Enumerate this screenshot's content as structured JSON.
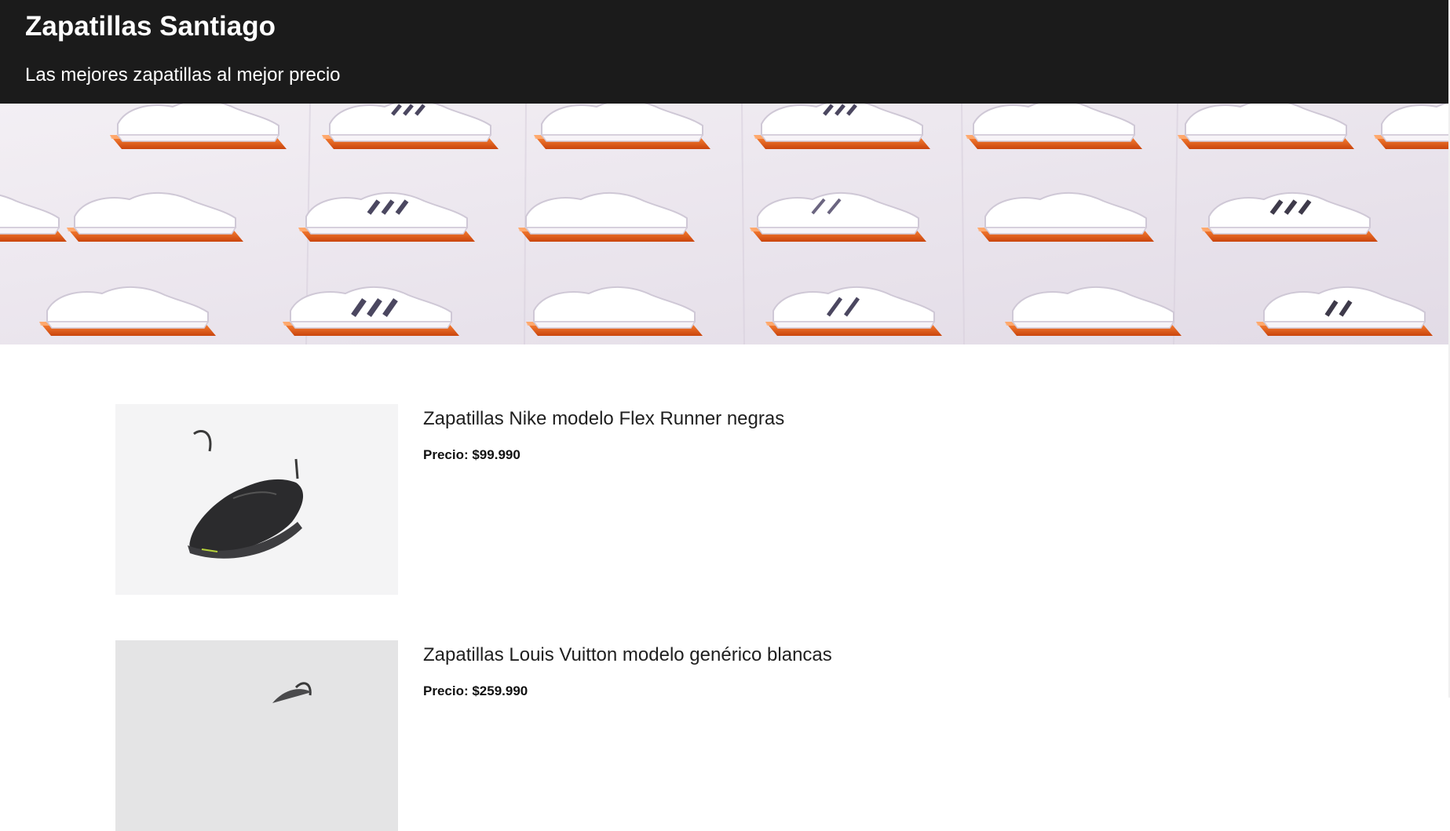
{
  "header": {
    "title": "Zapatillas Santiago",
    "tagline": "Las mejores zapatillas al mejor precio"
  },
  "hero": {
    "image": "sneaker-wall-photo",
    "shelf_color": "#e8631c",
    "wall_color": "#ebe6ee"
  },
  "products": [
    {
      "name": "Zapatillas Nike modelo Flex Runner negras",
      "price": "Precio: $99.990",
      "image": "black-nike-sneaker-photo"
    },
    {
      "name": "Zapatillas Louis Vuitton modelo genérico blancas",
      "price": "Precio: $259.990",
      "image": "grey-sneaker-photo"
    }
  ],
  "colors": {
    "header_bg": "#1b1b1b",
    "header_text": "#ffffff",
    "page_bg": "#ffffff"
  }
}
